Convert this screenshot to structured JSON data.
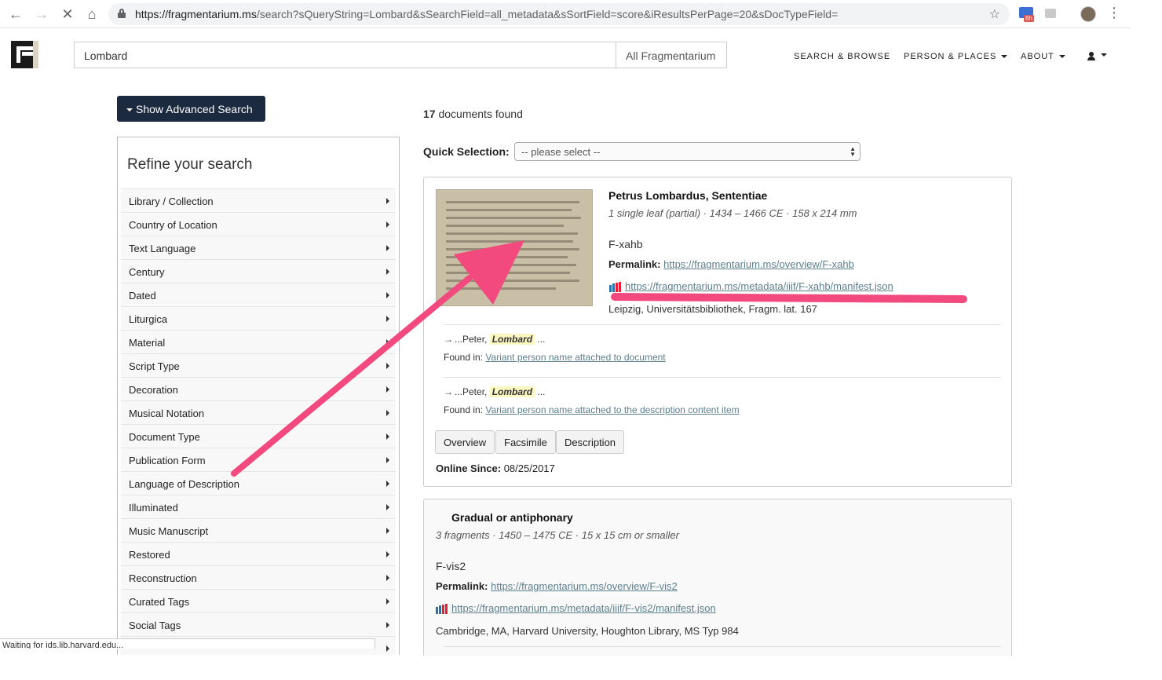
{
  "browser": {
    "url_host": "https://fragmentarium.ms",
    "url_rest": "/search?sQueryString=Lombard&sSearchField=all_metadata&sSortField=score&iResultsPerPage=20&sDocTypeField=",
    "ext_badge": "8h",
    "status": "Waiting for ids.lib.harvard.edu..."
  },
  "header": {
    "search_value": "Lombard",
    "scope": "All Fragmentarium",
    "nav": [
      "SEARCH & BROWSE",
      "PERSON & PLACES",
      "ABOUT"
    ]
  },
  "sidebar": {
    "advanced_button": "Show Advanced Search",
    "refine_title": "Refine your search",
    "facets": [
      "Library / Collection",
      "Country of Location",
      "Text Language",
      "Century",
      "Dated",
      "Liturgica",
      "Material",
      "Script Type",
      "Decoration",
      "Musical Notation",
      "Document Type",
      "Publication Form",
      "Language of Description",
      "Illuminated",
      "Music Manuscript",
      "Restored",
      "Reconstruction",
      "Curated Tags",
      "Social Tags",
      ""
    ]
  },
  "results": {
    "count": "17",
    "count_suffix": " documents found",
    "quick_selection_label": "Quick Selection:",
    "quick_selection_value": "-- please select --",
    "items": [
      {
        "title": "Petrus Lombardus, Sententiae",
        "meta": "1 single leaf (partial) · 1434 – 1466 CE · 158 x 214 mm",
        "shelfmark": "F-xahb",
        "permalink_label": "Permalink:",
        "permalink": "https://fragmentarium.ms/overview/F-xahb",
        "manifest": "https://fragmentarium.ms/metadata/iiif/F-xahb/manifest.json",
        "location": "Leipzig, Universitätsbibliothek, Fragm. lat. 167",
        "hits": [
          {
            "before": "...Peter, ",
            "term": "Lombard",
            "after": " ...",
            "found_label": "Found in: ",
            "found": "Variant person name attached to document"
          },
          {
            "before": "...Peter, ",
            "term": "Lombard",
            "after": " ...",
            "found_label": "Found in: ",
            "found": "Variant person name attached to the description content item"
          }
        ],
        "buttons": [
          "Overview",
          "Facsimile",
          "Description"
        ],
        "online_label": "Online Since:",
        "online": "08/25/2017"
      },
      {
        "title": "Gradual or antiphonary",
        "meta": "3 fragments · 1450 – 1475 CE · 15 x 15 cm or smaller",
        "shelfmark": "F-vis2",
        "permalink_label": "Permalink:",
        "permalink": "https://fragmentarium.ms/overview/F-vis2",
        "manifest": "https://fragmentarium.ms/metadata/iiif/F-vis2/manifest.json",
        "location": "Cambridge, MA, Harvard University, Houghton Library, MS Typ 984"
      }
    ]
  },
  "colors": {
    "annotation": "#f24a7f",
    "link": "#5d7f8c",
    "button_dark": "#1b2a3f",
    "highlight": "#fcf8c1"
  }
}
